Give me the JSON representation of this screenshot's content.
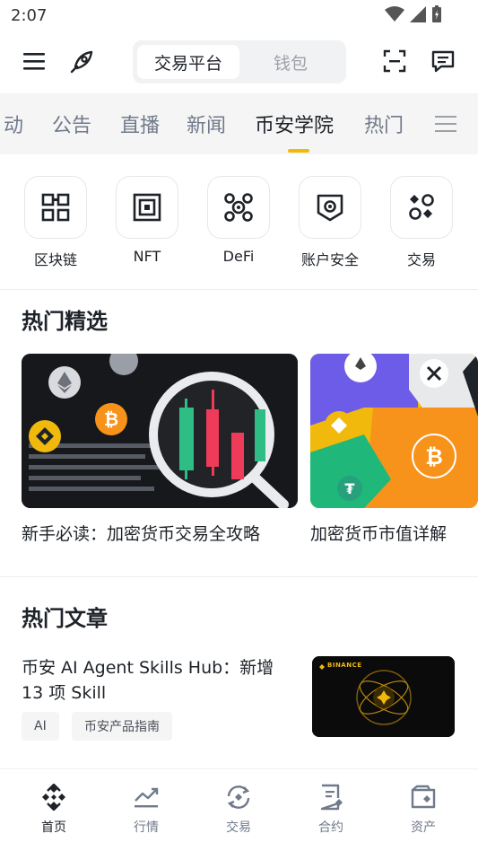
{
  "status_bar": {
    "time": "2:07"
  },
  "header": {
    "segments": {
      "active": "交易平台",
      "inactive": "钱包"
    }
  },
  "categories": [
    {
      "label": "动"
    },
    {
      "label": "公告"
    },
    {
      "label": "直播"
    },
    {
      "label": "新闻"
    },
    {
      "label": "币安学院",
      "active": true
    },
    {
      "label": "热门"
    }
  ],
  "quick_links": [
    {
      "label": "区块链",
      "icon": "blocks-icon"
    },
    {
      "label": "NFT",
      "icon": "nft-icon"
    },
    {
      "label": "DeFi",
      "icon": "defi-icon"
    },
    {
      "label": "账户安全",
      "icon": "shield-icon"
    },
    {
      "label": "交易",
      "icon": "trade-icon"
    }
  ],
  "featured": {
    "title": "热门精选",
    "cards": [
      {
        "caption": "新手必读：加密货币交易全攻略"
      },
      {
        "caption": "加密货币市值详解"
      }
    ]
  },
  "articles": {
    "title": "热门文章",
    "items": [
      {
        "title": "币安 AI Agent Skills Hub：新增 13 项 Skill",
        "tags": [
          "AI",
          "币安产品指南"
        ],
        "thumb_brand": "BINANCE"
      }
    ]
  },
  "bottom_nav": [
    {
      "label": "首页",
      "icon": "binance-home-icon",
      "active": true
    },
    {
      "label": "行情",
      "icon": "market-chart-icon"
    },
    {
      "label": "交易",
      "icon": "trade-swap-icon"
    },
    {
      "label": "合约",
      "icon": "futures-doc-icon"
    },
    {
      "label": "资产",
      "icon": "wallet-icon"
    }
  ],
  "colors": {
    "accent": "#F0B90B",
    "text": "#1E2329",
    "muted": "#707A8A"
  }
}
